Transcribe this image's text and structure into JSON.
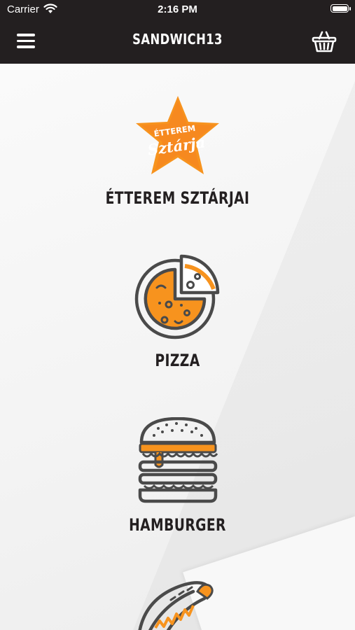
{
  "status_bar": {
    "carrier": "Carrier",
    "time": "2:16 PM"
  },
  "header": {
    "title": "SANDWICH13",
    "menu_icon": "hamburger-menu-icon",
    "cart_icon": "basket-icon"
  },
  "categories": [
    {
      "label": "ÉTTEREM SZTÁRJAI",
      "icon": "star-badge-icon",
      "badge_line1": "ÉTTEREM",
      "badge_line2": "Sztárja"
    },
    {
      "label": "PIZZA",
      "icon": "pizza-icon"
    },
    {
      "label": "HAMBURGER",
      "icon": "burger-icon"
    },
    {
      "label": "",
      "icon": "hotdog-icon"
    }
  ],
  "colors": {
    "header_bg": "#231f20",
    "accent": "#f7931e",
    "icon_stroke": "#4a4a4a"
  }
}
